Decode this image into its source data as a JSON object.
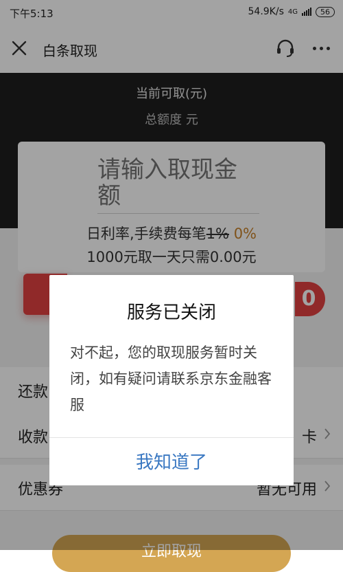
{
  "status_bar": {
    "time": "下午5:13",
    "speed": "54.9K/s",
    "network": "4G",
    "battery": "56"
  },
  "header": {
    "title": "白条取现",
    "icons": {
      "close": "close-icon",
      "service": "customer-service-icon",
      "more": "more-icon"
    }
  },
  "hero": {
    "available_label": "当前可取(元)",
    "total_label": "总额度 元"
  },
  "card": {
    "amount_placeholder": "请输入取现金额",
    "rate_prefix": "日利率,手续费每笔",
    "rate_old": "1%",
    "rate_new": "0%",
    "cost_text": "1000元取一天只需0.00元"
  },
  "promo": {
    "badge_text": "0"
  },
  "rows": [
    {
      "label": "还款",
      "value": ""
    },
    {
      "label": "收款",
      "value": "卡"
    },
    {
      "label": "优惠券",
      "value": "暂无可用"
    }
  ],
  "bottom_button": {
    "label": "立即取现"
  },
  "dialog": {
    "title": "服务已关闭",
    "message": "对不起，您的取现服务暂时关闭，如有疑问请联系京东金融客服",
    "button": "我知道了"
  },
  "colors": {
    "hero_bg": "#1f1f1f",
    "accent_gold": "#c8832b",
    "promo_red": "#e24141",
    "dialog_button_blue": "#3a78c2",
    "overlay": "rgba(0,0,0,0.36)"
  }
}
